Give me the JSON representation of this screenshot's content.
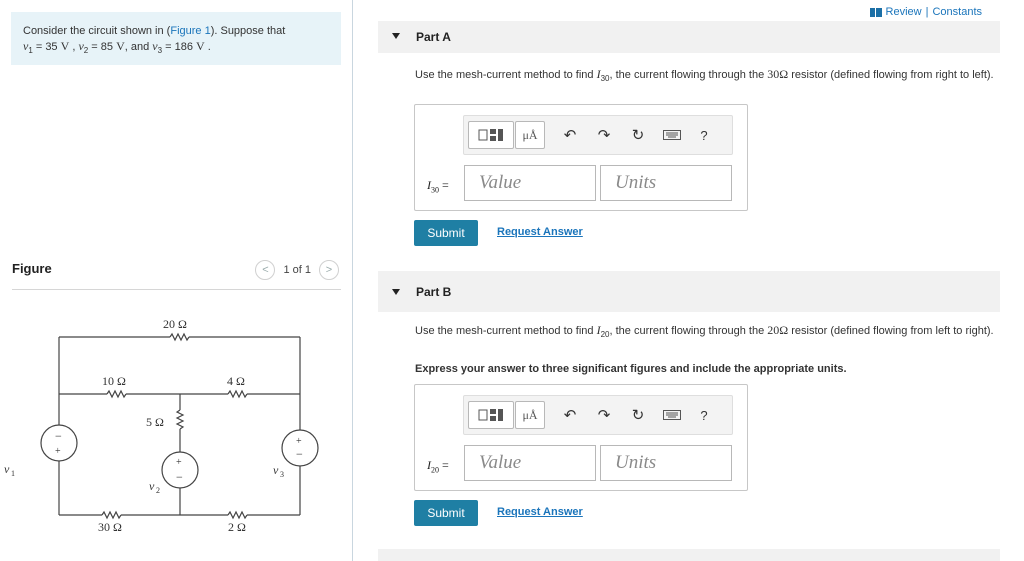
{
  "problem": {
    "text_before_link": "Consider the circuit shown in (",
    "link": "Figure 1",
    "text_after_link": "). Suppose that",
    "v1_sym": "v",
    "v1_sub": "1",
    "v1_val": " = 35 ",
    "v1_unit": "V",
    "v2_sym": "v",
    "v2_sub": "2",
    "v2_val": " = 85 ",
    "v2_unit": "V",
    "and": ", and ",
    "v3_sym": "v",
    "v3_sub": "3",
    "v3_val": " = 186 ",
    "v3_unit": "V",
    "end": " ."
  },
  "figure": {
    "title": "Figure",
    "pager": "1 of 1",
    "prev_icon": "<",
    "next_icon": ">",
    "labels": {
      "r20": "20 Ω",
      "r10": "10 Ω",
      "r4": "4 Ω",
      "r5": "5 Ω",
      "r30": "30 Ω",
      "r2": "2 Ω",
      "v1": "v",
      "v1sub": "1",
      "v2": "v",
      "v2sub": "2",
      "v3": "v",
      "v3sub": "3",
      "plus": "+",
      "minus": "−"
    }
  },
  "header": {
    "review": "Review",
    "sep": " | ",
    "constants": "Constants"
  },
  "parts": [
    {
      "title": "Part A",
      "text_1": "Use the mesh-current method to find ",
      "var_sym": "I",
      "var_sub": "30",
      "text_2": ", the current flowing through the ",
      "res": "30Ω",
      "text_3": " resistor (defined flowing from right to left).",
      "instruction": "",
      "label_sym": "I",
      "label_sub": "30",
      "eq": " = ",
      "value_placeholder": "Value",
      "units_placeholder": "Units",
      "submit": "Submit",
      "request": "Request Answer"
    },
    {
      "title": "Part B",
      "text_1": "Use the mesh-current method to find ",
      "var_sym": "I",
      "var_sub": "20",
      "text_2": ", the current flowing through the ",
      "res": "20Ω",
      "text_3": " resistor (defined flowing from left to right).",
      "instruction": "Express your answer to three significant figures and include the appropriate units.",
      "label_sym": "I",
      "label_sub": "20",
      "eq": " = ",
      "value_placeholder": "Value",
      "units_placeholder": "Units",
      "submit": "Submit",
      "request": "Request Answer"
    }
  ],
  "toolbar": {
    "mu_label": "μÅ",
    "undo": "↶",
    "redo": "↷",
    "reset": "↻",
    "help": "?",
    "icons": [
      "templates-icon",
      "units-icon",
      "undo-icon",
      "redo-icon",
      "reset-icon",
      "keyboard-icon",
      "help-icon"
    ]
  }
}
